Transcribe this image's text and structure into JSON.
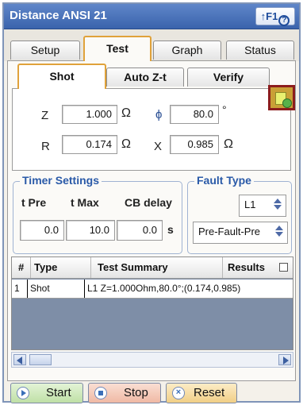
{
  "window": {
    "title": "Distance ANSI 21",
    "help_label": "↑F1"
  },
  "tabs": [
    "Setup",
    "Test",
    "Graph",
    "Status"
  ],
  "active_tab": "Test",
  "subtabs": [
    "Shot",
    "Auto Z-t",
    "Verify"
  ],
  "active_subtab": "Shot",
  "shot": {
    "z_label": "Z",
    "z_value": "1.000",
    "z_unit": "Ω",
    "phi_label": "ϕ",
    "phi_value": "80.0",
    "phi_unit": "°",
    "r_label": "R",
    "r_value": "0.174",
    "r_unit": "Ω",
    "x_label": "X",
    "x_value": "0.985",
    "x_unit": "Ω"
  },
  "timer": {
    "title": "Timer Settings",
    "headers": [
      "t Pre",
      "t Max",
      "CB delay"
    ],
    "values": [
      "0.0",
      "10.0",
      "0.0"
    ],
    "unit": "s"
  },
  "fault": {
    "title": "Fault Type",
    "type_value": "L1",
    "mode_value": "Pre-Fault-Pre"
  },
  "table": {
    "headers": [
      "#",
      "Type",
      "Test Summary",
      "Results"
    ],
    "rows": [
      [
        "1",
        "Shot",
        "L1 Z=1.000Ohm,80.0°;(0.174,0.985)"
      ]
    ]
  },
  "buttons": {
    "start": "Start",
    "stop": "Stop",
    "reset": "Reset"
  },
  "colors": {
    "titlebar": "#3a63ac",
    "active_tab_border": "#e0a23a",
    "run_button_border": "#8c1d1d",
    "start_bg": "#cde8b8",
    "stop_bg": "#f3c7b5",
    "reset_bg": "#f6dfa8"
  }
}
